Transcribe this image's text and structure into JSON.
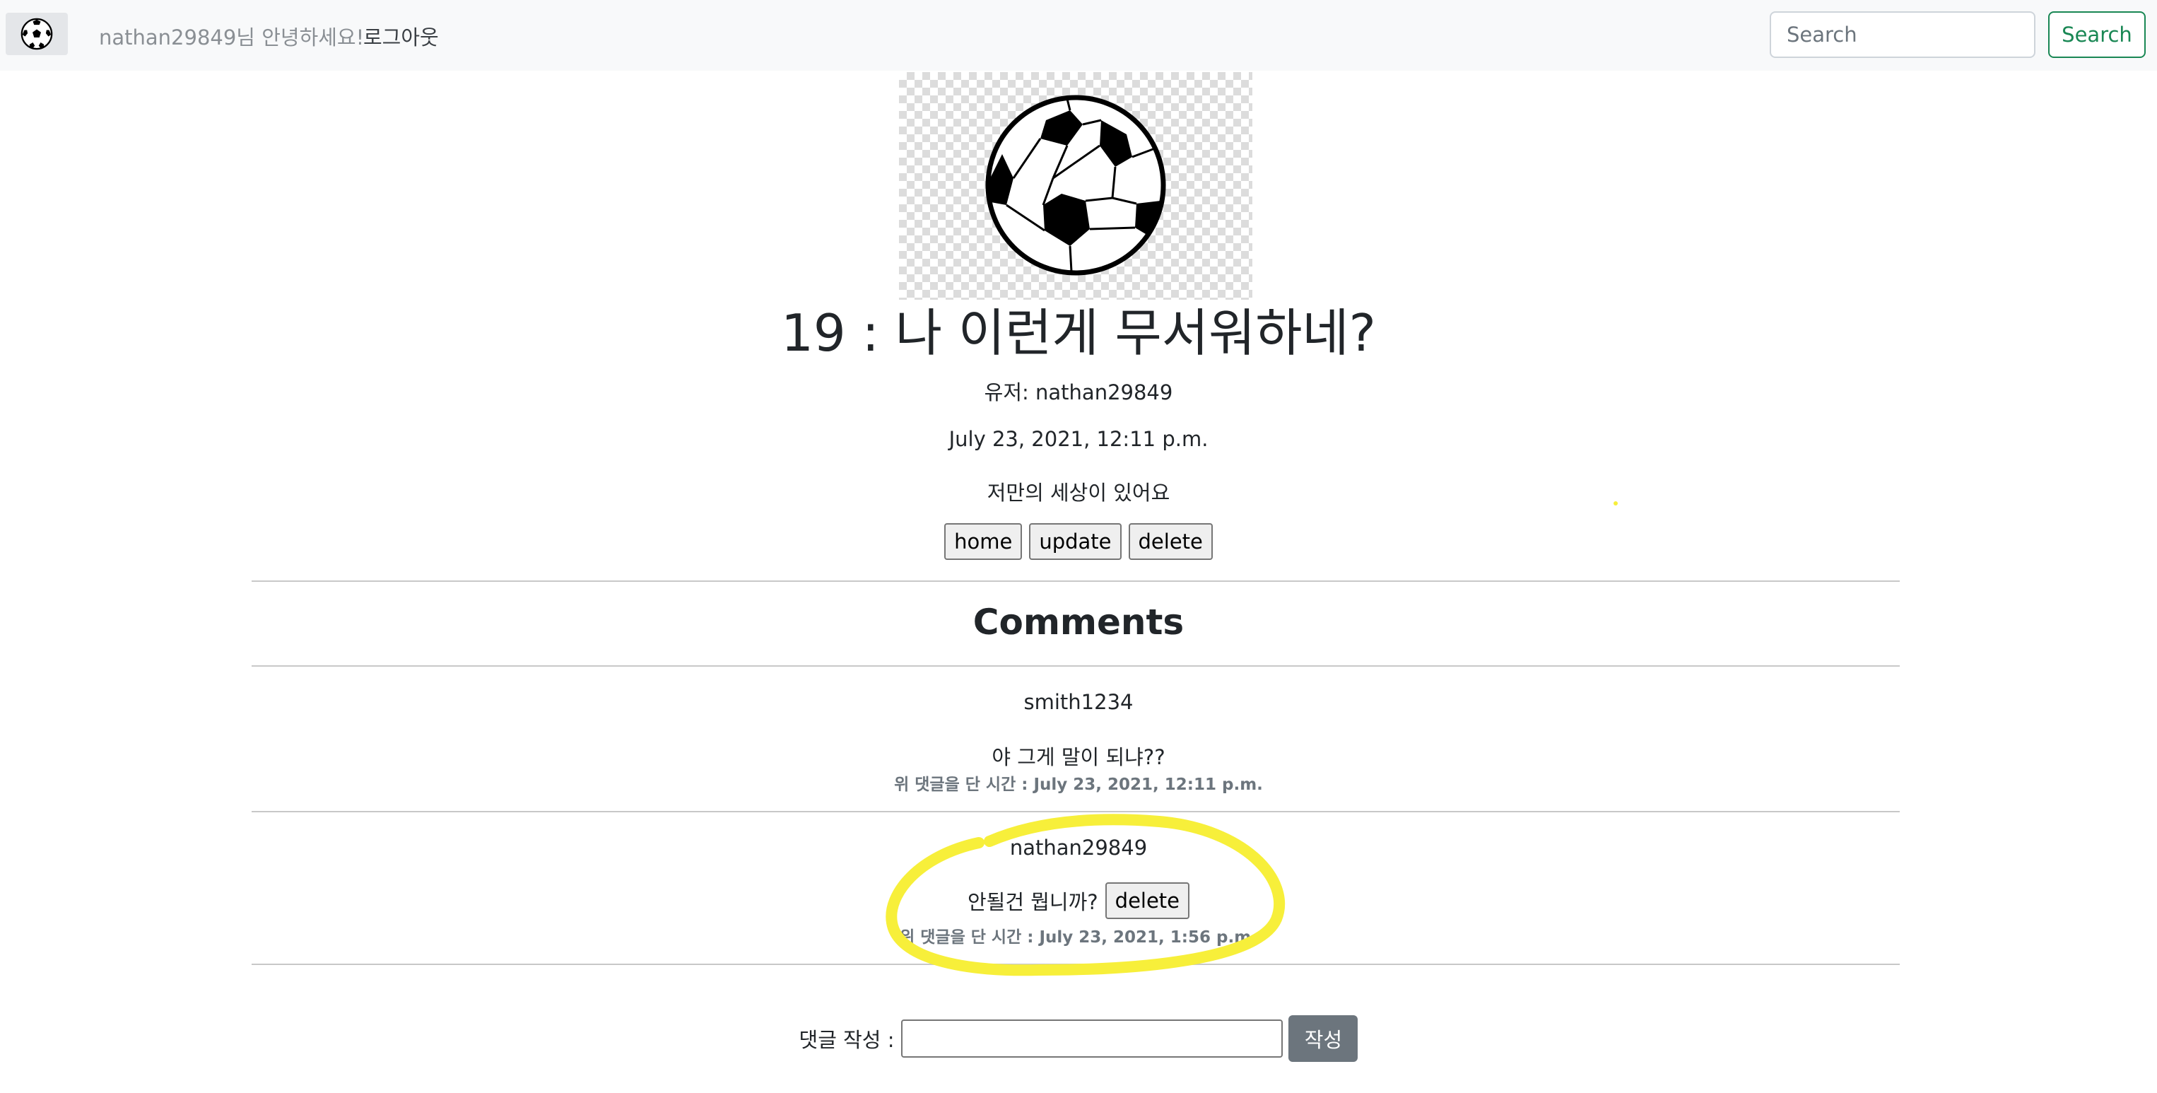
{
  "navbar": {
    "brand_icon": "soccer-ball-icon",
    "greeting": "nathan29849님 안녕하세요!",
    "logout_label": "로그아웃",
    "search_placeholder": "Search",
    "search_button_label": "Search"
  },
  "post": {
    "image_icon": "soccer-ball-icon",
    "title": "19 : 나 이런게 무서워하네?",
    "user_line": "유저: nathan29849",
    "date": "July 23, 2021, 12:11 p.m.",
    "body": "저만의 세상이 있어요",
    "buttons": {
      "home": "home",
      "update": "update",
      "delete": "delete"
    }
  },
  "comments": {
    "heading": "Comments",
    "items": [
      {
        "author": "smith1234",
        "text": "야 그게 말이 되냐??",
        "meta": "위 댓글을 단 시간 : July 23, 2021, 12:11 p.m."
      },
      {
        "author": "nathan29849",
        "text": "안될건 뭡니까?",
        "delete_label": "delete",
        "meta": "위 댓글을 단 시간 : July 23, 2021, 1:56 p.m."
      }
    ]
  },
  "comment_form": {
    "label": "댓글 작성 :",
    "input_value": "",
    "submit_label": "작성"
  },
  "colors": {
    "navbar_bg": "#f8f9fa",
    "search_button": "#198754",
    "submit_button": "#6c757d",
    "highlight": "#f7ef3a"
  }
}
